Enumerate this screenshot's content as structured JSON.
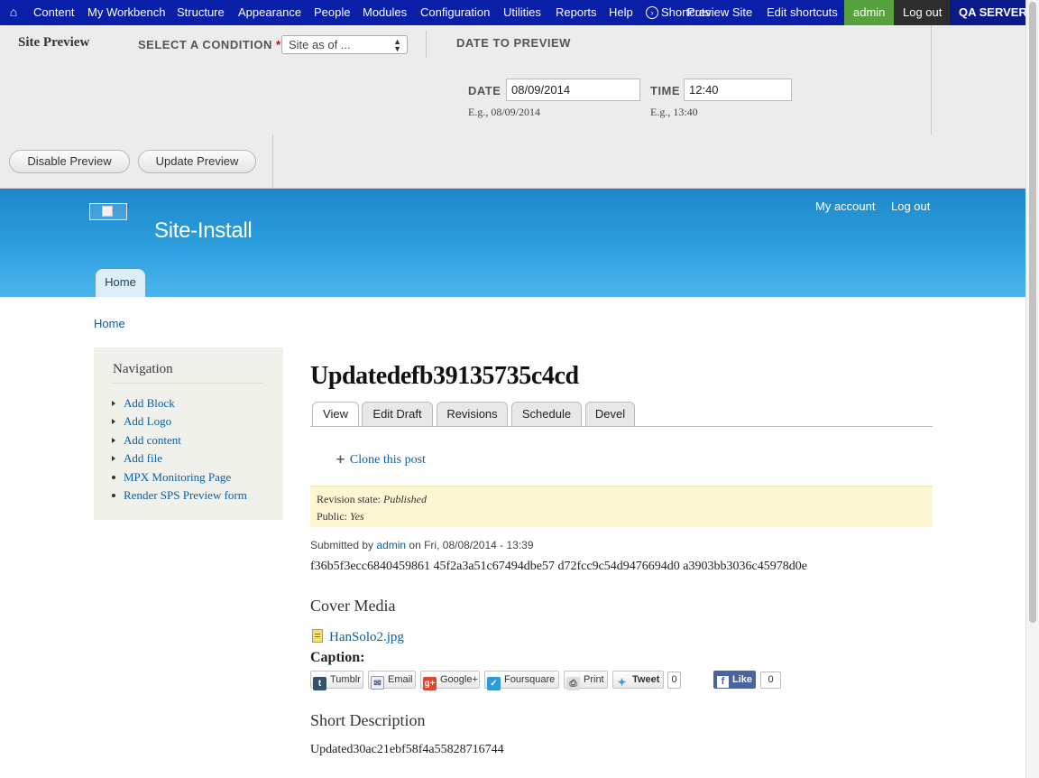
{
  "toolbar": {
    "items": [
      "Content",
      "My Workbench",
      "Structure",
      "Appearance",
      "People",
      "Modules",
      "Configuration",
      "Utilities",
      "Reports",
      "Help"
    ],
    "shortcuts_label": "Shortcuts",
    "preview_site": "Preview Site",
    "edit_shortcuts": "Edit shortcuts",
    "user": "admin",
    "logout": "Log out",
    "server": "QA SERVER",
    "colors": {
      "bar": "#0a1fa8",
      "admin": "#56a03d",
      "logout": "#2e2e2e"
    }
  },
  "preview": {
    "title": "Site Preview",
    "condition_label": "SELECT A CONDITION",
    "required_mark": "*",
    "condition_value": "Site as of ...",
    "date_to_preview": "DATE TO PREVIEW",
    "date_label": "DATE",
    "date_value": "08/09/2014",
    "date_hint": "E.g., 08/09/2014",
    "time_label": "TIME",
    "time_value": "12:40",
    "time_hint": "E.g., 13:40",
    "disable_button": "Disable Preview",
    "update_button": "Update Preview"
  },
  "header": {
    "site_name": "Site-Install",
    "my_account": "My account",
    "logout": "Log out",
    "home_tab": "Home"
  },
  "breadcrumb": "Home",
  "sidebar": {
    "title": "Navigation",
    "items": [
      "Add Block",
      "Add Logo",
      "Add content",
      "Add file",
      "MPX Monitoring Page",
      "Render SPS Preview form"
    ]
  },
  "node": {
    "title": "Updatedefb39135735c4cd",
    "tabs": [
      "View",
      "Edit Draft",
      "Revisions",
      "Schedule",
      "Devel"
    ],
    "clone_link": "Clone this post",
    "revision_state_label": "Revision state:",
    "revision_state_value": "Published",
    "public_label": "Public:",
    "public_value": "Yes",
    "submitted_prefix": "Submitted by",
    "submitted_user": "admin",
    "submitted_suffix": "on Fri, 08/08/2014 - 13:39",
    "body_hashes": "f36b5f3ecc6840459861 45f2a3a51c67494dbe57 d72fcc9c54d9476694d0 a3903bb3036c45978d0e",
    "cover_media_heading": "Cover Media",
    "file_name": "HanSolo2.jpg",
    "caption_label": "Caption:",
    "short_description_heading": "Short Description",
    "short_description": "Updated30ac21ebf58f4a55828716744"
  },
  "share": {
    "tumblr": "Tumblr",
    "email": "Email",
    "googleplus": "Google+",
    "foursquare": "Foursquare",
    "print": "Print",
    "tweet": "Tweet",
    "tweet_count": "0",
    "like": "Like",
    "like_count": "0"
  }
}
